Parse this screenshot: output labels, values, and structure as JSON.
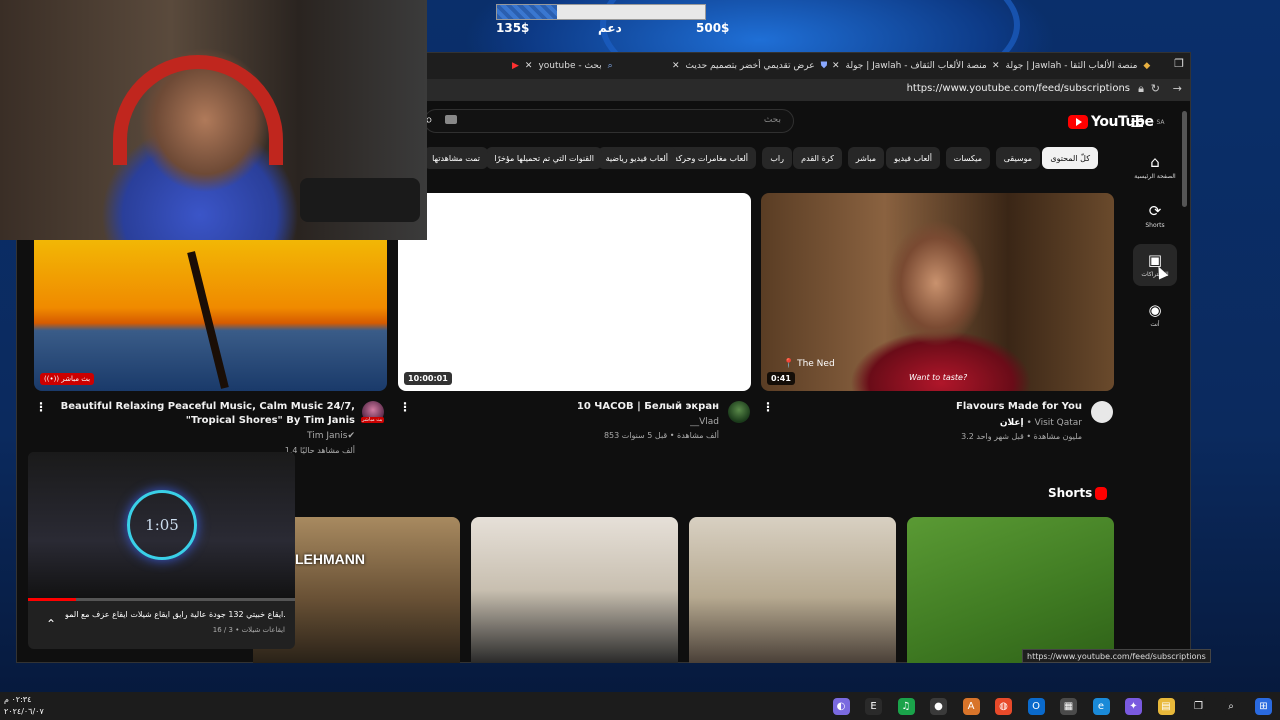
{
  "donation": {
    "min": "135$",
    "label": "دعم",
    "max": "500$",
    "progress": 0.29
  },
  "browser": {
    "tabs": [
      {
        "label": "جولة | Jawlah - منصة الألعاب الثقا",
        "icon": "jawlah-icon"
      },
      {
        "label": "جولة | Jawlah - منصة الألعاب الثقاف",
        "icon": "jawlah-icon"
      },
      {
        "label": "عرض تقديمي أخضر بتصميم حديث",
        "icon": "shield-icon"
      },
      {
        "label": "youtube - بحث",
        "icon": "search-icon"
      },
      {
        "label": "",
        "icon": "youtube-icon"
      }
    ],
    "url": "https://www.youtube.com/feed/subscriptions",
    "status_url": "https://www.youtube.com/feed/subscriptions"
  },
  "youtube": {
    "logo_text": "YouTube",
    "logo_region": "SA",
    "search_placeholder": "بحث",
    "chips": [
      "كلّ المحتوى",
      "موسيقى",
      "ميكسات",
      "ألعاب فيديو",
      "مباشر",
      "كرة القدم",
      "راب",
      "ألعاب مغامرات وحركة",
      "ألعاب فيديو رياضية",
      "القنوات التي تم تحميلها مؤخرًا",
      "تمت مشاهدتها"
    ],
    "nav": [
      {
        "label": "الصفحة الرئيسية",
        "icon": "home-icon"
      },
      {
        "label": "Shorts",
        "icon": "shorts-icon"
      },
      {
        "label": "الاشتراكات",
        "icon": "subscriptions-icon"
      },
      {
        "label": "أنت",
        "icon": "user-icon"
      }
    ],
    "videos": [
      {
        "title": "Flavours Made for You",
        "channel": "Visit Qatar",
        "ad_label": "إعلان",
        "meta": "3.2 مليون مشاهدة • قبل شهر واحد",
        "duration": "0:41",
        "overlay_brand": "The Ned",
        "overlay_tag": "Want to taste?"
      },
      {
        "title": "10 ЧАСОВ | Белый экран",
        "channel": "__Vlad",
        "meta": "853 ألف مشاهدة • قبل 5 سنوات",
        "duration": "10:00:01"
      },
      {
        "title": "Beautiful Relaxing Peaceful Music, Calm Music 24/7, \"Tropical Shores\" By Tim Janis",
        "channel": "Tim Janis",
        "meta": "1.4 ألف مشاهد حاليًا",
        "live": "بث مباشر",
        "avatar_badge": "بث مباشر"
      }
    ],
    "shorts_title": "Shorts",
    "shorts_overlay": "LEHMANN",
    "mini_player": {
      "clock": "1:05",
      "progress": 0.18,
      "title": "ايقاع خبيتي 132 جودة عالية رايق ايقاع شيلات ايقاع عزف مع المو...",
      "subtitle": "ايقاعات شيلات • 3 / 16"
    }
  },
  "taskbar": {
    "time": "٠٢:٣٤ م",
    "date": "٢٠٢٤/٠٦/٠٧",
    "icons": [
      "windows-icon",
      "search-icon",
      "task-view-icon",
      "file-explorer-icon",
      "copilot-icon",
      "edge-icon",
      "store-icon",
      "outlook-icon",
      "chrome-icon",
      "app-icon",
      "obs-icon",
      "spotify-icon",
      "epic-games-icon",
      "discord-icon"
    ]
  }
}
